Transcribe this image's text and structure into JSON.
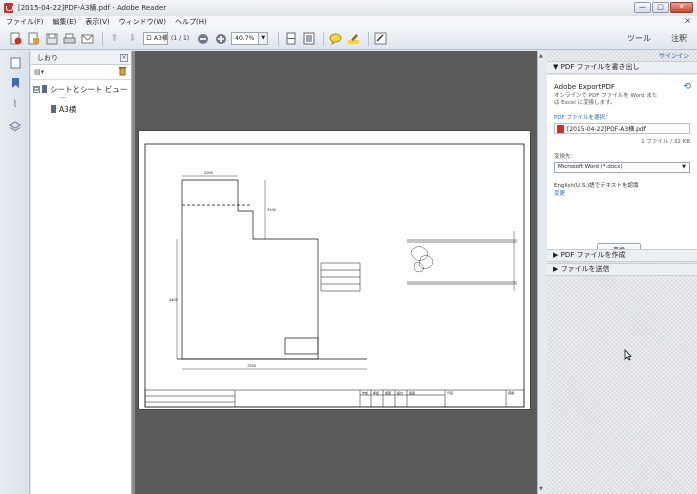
{
  "window": {
    "title": "[2015-04-22]PDF-A3横.pdf - Adobe Reader",
    "controls": {
      "minimize": "—",
      "maximize": "□",
      "close": "✕"
    }
  },
  "menu": {
    "items": [
      "ファイル(F)",
      "編集(E)",
      "表示(V)",
      "ウィンドウ(W)",
      "ヘルプ(H)"
    ],
    "close_doc": "×"
  },
  "toolbar": {
    "page_value": "ロ A3横",
    "page_count": "(1 / 1)",
    "zoom_value": "40.7%",
    "tools_label": "ツール",
    "comment_label": "注釈"
  },
  "bookmarks": {
    "title": "しおり",
    "close": "×",
    "options": "▤▾",
    "tree": [
      {
        "label": "シートとシート ビュー",
        "expander": "⊟"
      },
      {
        "label": "A3横"
      }
    ],
    "dash": "—"
  },
  "drawing": {
    "dim_top": "2000",
    "dim_right": "3200",
    "dim_left": "4400",
    "dim_bottom": "7200",
    "title_block": [
      "作成",
      "承認",
      "検図",
      "設計",
      "製図",
      "尺度",
      "図番"
    ]
  },
  "right_pane": {
    "sign_in": "サインイン",
    "export_header": "PDF ファイルを書き出し",
    "export_title": "Adobe ExportPDF",
    "export_desc": "オンラインで PDF ファイルを Word または Excel に変換します。",
    "select_file_label": "PDF ファイルを選択：",
    "file_name": "[2015-04-22]PDF-A3横.pdf",
    "file_count": "1 ファイル / 32 KB",
    "convert_to_label": "変換先：",
    "convert_option": "Microsoft Word (*.docx)",
    "language_text": "English(U.S.)語でテキストを認識",
    "change_link": "変更",
    "convert_button": "変換",
    "create_header": "PDF ファイルを作成",
    "send_header": "ファイルを送信"
  }
}
